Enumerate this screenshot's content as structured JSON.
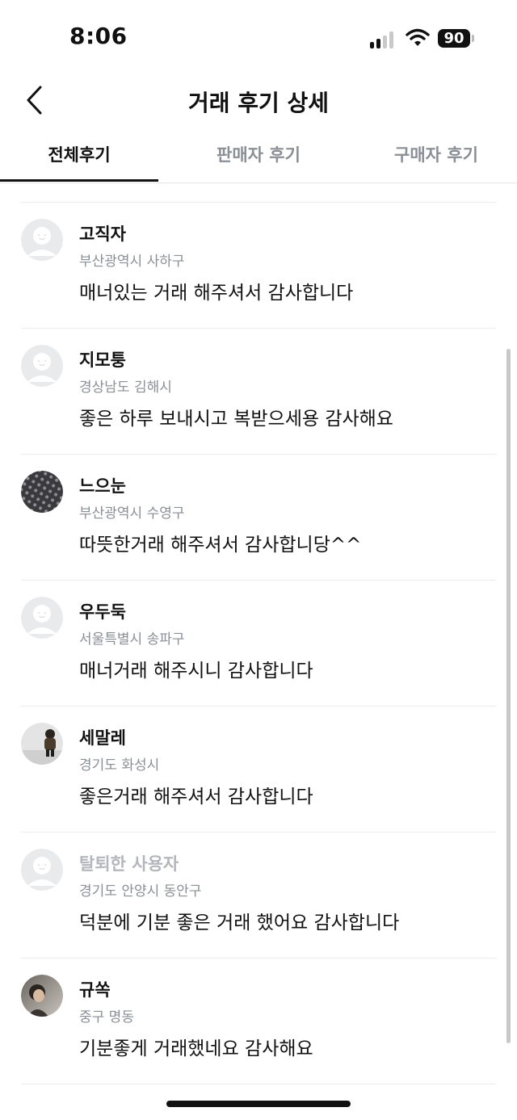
{
  "status_bar": {
    "time": "8:06",
    "battery": "90",
    "icons": [
      "cellular-signal-icon",
      "wifi-icon",
      "battery-icon"
    ]
  },
  "nav": {
    "back_icon": "chevron-left-icon",
    "title": "거래 후기 상세"
  },
  "tabs": [
    {
      "label": "전체후기",
      "active": true
    },
    {
      "label": "판매자 후기",
      "active": false
    },
    {
      "label": "구매자 후기",
      "active": false
    }
  ],
  "reviews": [
    {
      "name": "고직자",
      "region": "부산광역시 사하구",
      "content": "매너있는 거래 해주셔서 감사합니다",
      "avatar": "default-avatar"
    },
    {
      "name": "지모퉁",
      "region": "경상남도 김해시",
      "content": "좋은 하루 보내시고 복받으세용 감사해요",
      "avatar": "default-avatar"
    },
    {
      "name": "느으눈",
      "region": "부산광역시 수영구",
      "content": "따뜻한거래 해주셔서 감사합니당^^",
      "avatar": "pattern-photo"
    },
    {
      "name": "우두둑",
      "region": "서울특별시 송파구",
      "content": "매너거래 해주시니 감사합니다",
      "avatar": "default-avatar"
    },
    {
      "name": "세말레",
      "region": "경기도 화성시",
      "content": "좋은거래 해주셔서 감사합니다",
      "avatar": "person-photo"
    },
    {
      "name": "탈퇴한 사용자",
      "region": "경기도 안양시 동안구",
      "content": "덕분에 기분 좋은 거래 했어요 감사합니다",
      "avatar": "default-avatar",
      "withdrawn": true
    },
    {
      "name": "규쏙",
      "region": "중구 명동",
      "content": "기분좋게 거래했네요 감사해요",
      "avatar": "person-photo-2"
    }
  ],
  "colors": {
    "text_primary": "#111111",
    "text_secondary": "#8a8f96",
    "withdrawn_name": "#b3b6ba",
    "divider": "#ececec",
    "default_avatar_bg": "#e9eaec"
  }
}
